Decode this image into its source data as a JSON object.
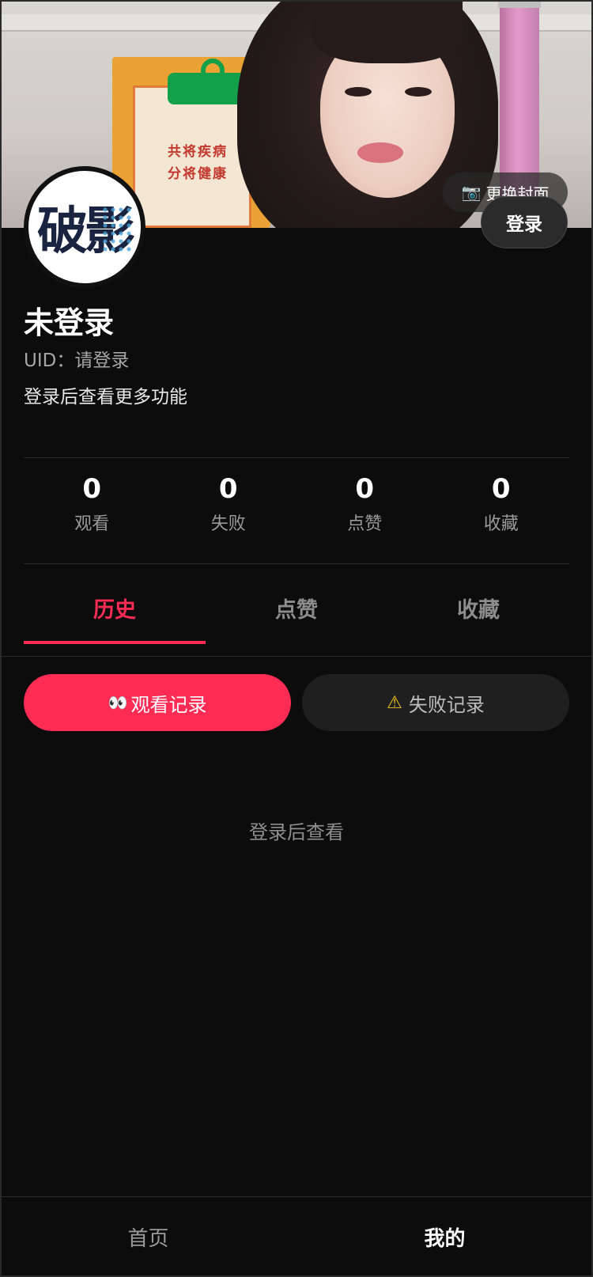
{
  "cover": {
    "notice_line1": "共将疾病",
    "notice_line2": "分将健康",
    "change_cover_label": "更换封面",
    "camera_icon": "📷"
  },
  "header": {
    "login_label": "登录",
    "avatar_text": "破影"
  },
  "profile": {
    "name": "未登录",
    "uid": "UID：请登录",
    "bio": "登录后查看更多功能"
  },
  "stats": [
    {
      "value": "0",
      "label": "观看"
    },
    {
      "value": "0",
      "label": "失败"
    },
    {
      "value": "0",
      "label": "点赞"
    },
    {
      "value": "0",
      "label": "收藏"
    }
  ],
  "tabs": [
    {
      "label": "历史",
      "active": true
    },
    {
      "label": "点赞",
      "active": false
    },
    {
      "label": "收藏",
      "active": false
    }
  ],
  "sub_tabs": {
    "watch": {
      "icon": "👀",
      "label": "观看记录"
    },
    "fail": {
      "icon": "⚠",
      "label": "失败记录"
    }
  },
  "empty_state": "登录后查看",
  "bottom_nav": [
    {
      "label": "首页",
      "active": false
    },
    {
      "label": "我的",
      "active": true
    }
  ],
  "colors": {
    "accent": "#fe2c55",
    "background": "#0c0c0c"
  }
}
